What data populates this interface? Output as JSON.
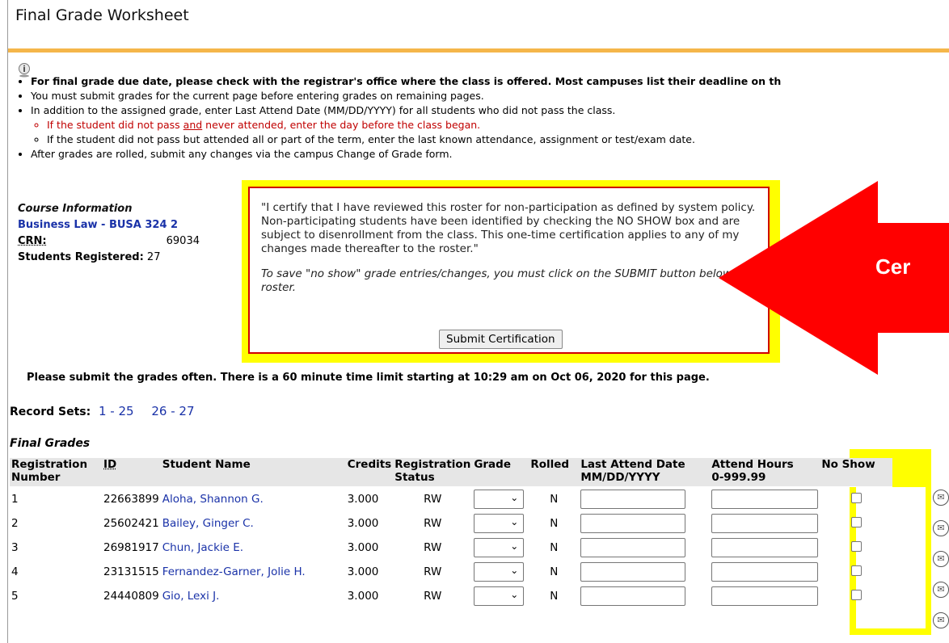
{
  "page": {
    "title": "Final Grade Worksheet"
  },
  "instructions": {
    "item1": "For final grade due date, please check with the registrar's office where the class is offered. Most campuses list their deadline on th",
    "item2": "You must submit grades for the current page before entering grades on remaining pages.",
    "item3": "In addition to the assigned grade, enter Last Attend Date (MM/DD/YYYY) for all students who did not pass the class.",
    "sub1_a": "If the student did not pass ",
    "sub1_b": "and",
    "sub1_c": " never attended, enter the day before the class began.",
    "sub2": "If the student did not pass but attended all or part of the term, enter the last known attendance, assignment or test/exam date.",
    "item4": "After grades are rolled, submit any changes via the campus Change of Grade form."
  },
  "course": {
    "heading": "Course Information",
    "name": "Business Law - BUSA 324 2",
    "crn_label": "CRN:",
    "crn_value": "69034",
    "registered_label": "Students Registered:",
    "registered_value": "27"
  },
  "certification": {
    "text": "\"I certify that I have reviewed this roster for non-participation as defined by system policy. Non-participating students have been identified by checking the NO SHOW box and are subject to disenrollment from the class. This one-time certification applies to any of my changes made thereafter to the roster.\"",
    "note": "To save \"no show\" grade entries/changes, you must click on the SUBMIT button below the roster.",
    "button_label": "Submit Certification",
    "arrow_label": "Cer"
  },
  "time_note": "Please submit the grades often. There is a 60 minute time limit starting at 10:29 am on Oct 06, 2020 for this page.",
  "record_sets": {
    "label": "Record Sets:",
    "links": [
      "1 - 25",
      "26 - 27"
    ]
  },
  "grades": {
    "label": "Final Grades",
    "headers": {
      "registration_number": "Registration Number",
      "id": "ID",
      "student_name": "Student Name",
      "credits": "Credits",
      "registration_status": "Registration Status",
      "grade": "Grade",
      "rolled": "Rolled",
      "last_attend_date": "Last Attend Date",
      "last_attend_format": "MM/DD/YYYY",
      "attend_hours": "Attend Hours",
      "attend_hours_range": "0-999.99",
      "no_show": "No Show"
    },
    "rows": [
      {
        "number": "1",
        "id": "22663899",
        "name": "Aloha, Shannon G.",
        "credits": "3.000",
        "status": "RW",
        "rolled": "N"
      },
      {
        "number": "2",
        "id": "25602421",
        "name": "Bailey, Ginger C.",
        "credits": "3.000",
        "status": "RW",
        "rolled": "N"
      },
      {
        "number": "3",
        "id": "26981917",
        "name": "Chun, Jackie E.",
        "credits": "3.000",
        "status": "RW",
        "rolled": "N"
      },
      {
        "number": "4",
        "id": "23131515",
        "name": "Fernandez-Garner, Jolie H.",
        "credits": "3.000",
        "status": "RW",
        "rolled": "N"
      },
      {
        "number": "5",
        "id": "24440809",
        "name": "Gio, Lexi J.",
        "credits": "3.000",
        "status": "RW",
        "rolled": "N"
      }
    ]
  },
  "colors": {
    "accent_bar": "#f5b64a",
    "highlight": "#ffff00",
    "annotation_red": "#ff0000",
    "link_blue": "#1a32a8"
  }
}
